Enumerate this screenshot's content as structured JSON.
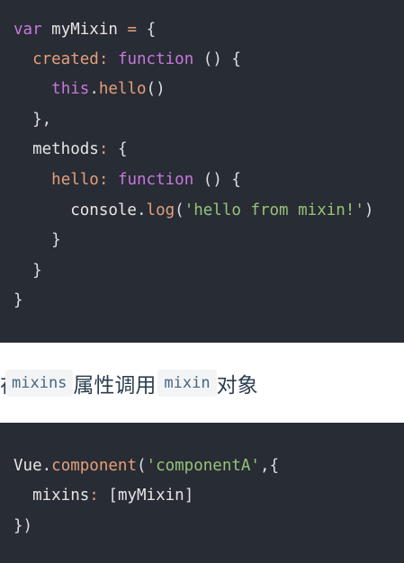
{
  "code_block_1": {
    "lines": [
      "var myMixin = {",
      "  created: function () {",
      "    this.hello()",
      "  },",
      "  methods: {",
      "    hello: function () {",
      "      console.log('hello from mixin!')",
      "    }",
      "  }",
      "}"
    ]
  },
  "prose": {
    "cut_text": "在",
    "code_1": "mixins",
    "text_1": "属性调用",
    "code_2": "mixin",
    "text_2": "对象"
  },
  "code_block_2": {
    "lines": [
      "Vue.component('componentA',{",
      "  mixins: [myMixin]",
      "})"
    ]
  },
  "colors": {
    "code_background": "#282c34",
    "keyword": "#c678dd",
    "property": "#e5a07b",
    "string": "#98c379",
    "text": "#dcdfe4",
    "inline_code_background": "#f3f4f5",
    "inline_code_text": "#476582",
    "prose_text": "#2c3e50"
  }
}
